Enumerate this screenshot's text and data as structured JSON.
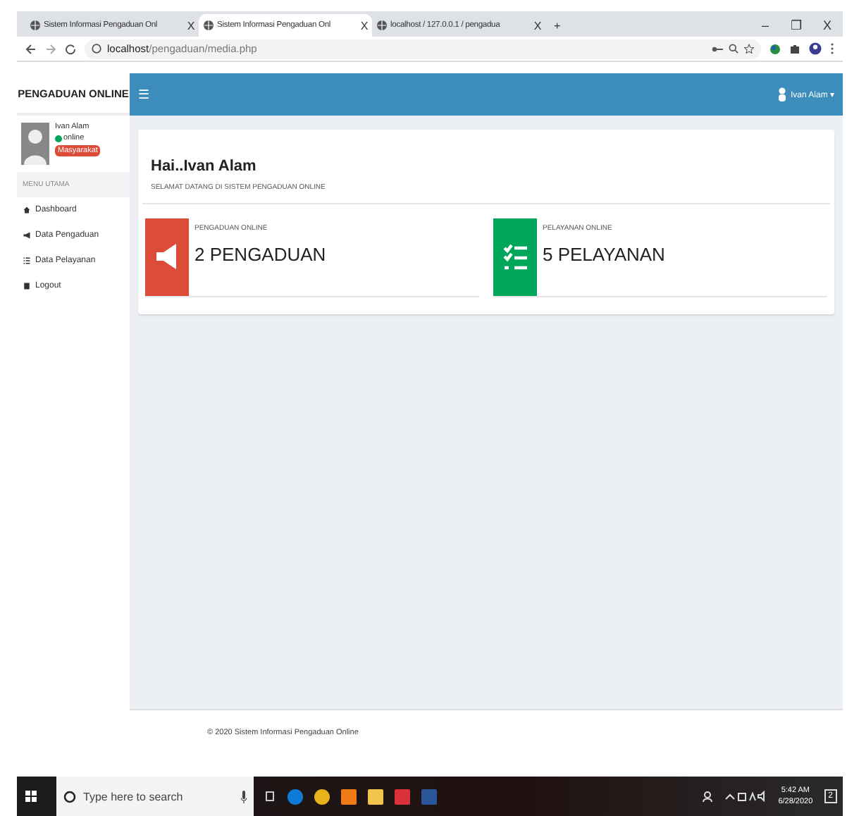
{
  "browser": {
    "tabs": [
      {
        "title": "Sistem Informasi Pengaduan Onl",
        "close": "X",
        "selected": false
      },
      {
        "title": "Sistem Informasi Pengaduan Onl",
        "close": "X",
        "selected": true
      },
      {
        "title": "localhost / 127.0.0.1 / pengadua",
        "close": "X",
        "selected": false
      }
    ],
    "new_tab": "+",
    "window_controls": [
      "–",
      "❐",
      "X"
    ],
    "address": {
      "host": "localhost",
      "path": "/pengaduan/media.php"
    }
  },
  "app": {
    "brand": "PENGADUAN ONLINE",
    "menu_toggle": "☰",
    "user_menu": "Ivan Alam ▾",
    "user": {
      "name": "Ivan Alam",
      "status": "online",
      "role": "Masyarakat"
    },
    "menu_heading": "MENU UTAMA",
    "menu": [
      {
        "label": "Dashboard",
        "kind": "home"
      },
      {
        "label": "Data Pengaduan",
        "kind": "megaphone"
      },
      {
        "label": "Data Pelayanan",
        "kind": "list"
      },
      {
        "label": "Logout",
        "kind": "book"
      }
    ],
    "greeting": "Hai..Ivan Alam",
    "welcome": "SELAMAT DATANG DI SISTEM PENGADUAN ONLINE",
    "stats": [
      {
        "label": "PENGADUAN ONLINE",
        "value": "2 PENGADUAN",
        "color": "#dd4b39",
        "kind": "megaphone"
      },
      {
        "label": "PELAYANAN ONLINE",
        "value": "5 PELAYANAN",
        "color": "#00a65a",
        "kind": "list"
      }
    ],
    "footer": "© 2020 Sistem Informasi Pengaduan Online"
  },
  "taskbar": {
    "search_placeholder": "Type here to search",
    "time": "5:42 AM",
    "date": "6/28/2020",
    "notifications": "2"
  }
}
